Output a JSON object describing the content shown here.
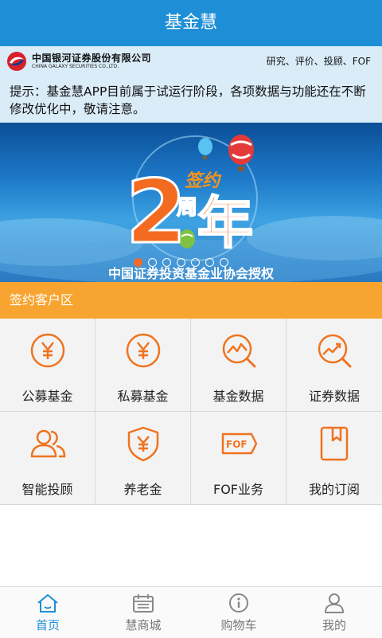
{
  "header": {
    "title": "基金慧"
  },
  "brand": {
    "name_cn": "中国银河证券股份有限公司",
    "name_en": "CHINA GALAXY SECURITIES CO.,LTD.",
    "tagline": "研究、评价、投顾、FOF"
  },
  "notice": {
    "text": "提示：基金慧APP目前属于试运行阶段，各项数据与功能还在不断修改优化中，敬请注意。"
  },
  "banner": {
    "headline_top": "签约",
    "headline_number": "2",
    "headline_zhou": "周",
    "headline_nian": "年",
    "caption": "中国证券投资基金业协会授权",
    "slide_count": 7,
    "active_slide": 1
  },
  "section": {
    "title": "签约客户区"
  },
  "grid": {
    "items": [
      {
        "label": "公募基金",
        "icon": "yuan-circle-icon"
      },
      {
        "label": "私募基金",
        "icon": "yuan-circle-icon"
      },
      {
        "label": "基金数据",
        "icon": "chart-magnifier-icon"
      },
      {
        "label": "证券数据",
        "icon": "chart-up-magnifier-icon"
      },
      {
        "label": "智能投顾",
        "icon": "users-icon"
      },
      {
        "label": "养老金",
        "icon": "yuan-shield-icon"
      },
      {
        "label": "FOF业务",
        "icon": "fof-tag-icon"
      },
      {
        "label": "我的订阅",
        "icon": "bookmark-book-icon"
      }
    ]
  },
  "nav": {
    "items": [
      {
        "label": "首页",
        "icon": "home-icon",
        "active": true
      },
      {
        "label": "慧商城",
        "icon": "calendar-icon",
        "active": false
      },
      {
        "label": "购物车",
        "icon": "info-icon",
        "active": false
      },
      {
        "label": "我的",
        "icon": "user-icon",
        "active": false
      }
    ]
  },
  "colors": {
    "primary": "#1e8fd6",
    "accent_orange": "#f0731f",
    "section_orange": "#f7a530",
    "notice_bg": "#d9ecf8"
  }
}
